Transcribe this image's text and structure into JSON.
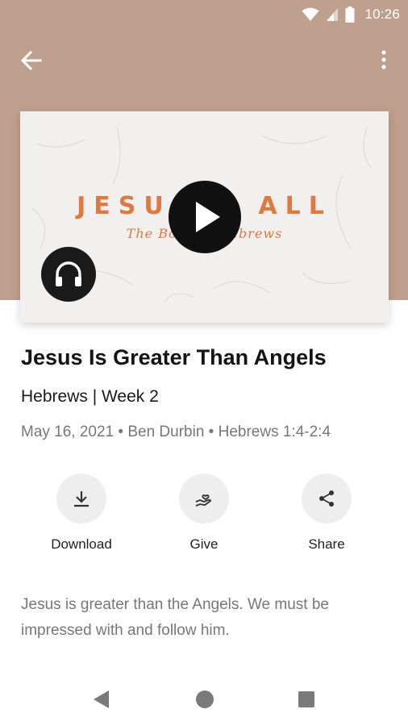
{
  "status_bar": {
    "time": "10:26",
    "icons": [
      "wifi-icon",
      "cellular-signal-icon",
      "battery-icon"
    ]
  },
  "app_bar": {
    "back_icon": "arrow-back-icon",
    "menu_icon": "more-vert-icon"
  },
  "colors": {
    "hero_background": "#bf9f8e",
    "thumbnail_accent": "#e0793f",
    "button_circle": "#eeeeee",
    "secondary_text": "#777777"
  },
  "thumbnail": {
    "title_text": "JESUS > ALL",
    "script_text": "The Book of Hebrews",
    "play_icon": "play-icon",
    "audio_icon": "headphones-icon"
  },
  "sermon": {
    "title": "Jesus Is Greater Than Angels",
    "series": "Hebrews | Week 2",
    "meta": "May 16, 2021 • Ben Durbin • Hebrews 1:4-2:4",
    "description": "Jesus is greater than the Angels. We must be impressed with and follow him."
  },
  "actions": [
    {
      "label": "Download",
      "icon": "download-icon"
    },
    {
      "label": "Give",
      "icon": "give-heart-hand-icon"
    },
    {
      "label": "Share",
      "icon": "share-icon"
    }
  ],
  "nav_bar": {
    "icons": [
      "nav-back-icon",
      "nav-home-icon",
      "nav-recents-icon"
    ]
  }
}
